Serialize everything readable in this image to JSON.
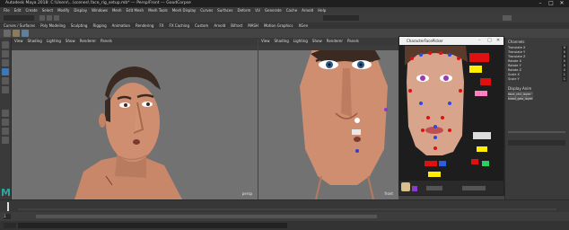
{
  "window": {
    "title": "Autodesk Maya 2018: C:\\Users\\...\\scenes\\ face_rig_setup.mb* --- Persp/Front --- GoodCorpse",
    "controls": [
      "–",
      "□",
      "✕"
    ]
  },
  "menubar": [
    "File",
    "Edit",
    "Create",
    "Select",
    "Modify",
    "Display",
    "Windows",
    "Mesh",
    "Edit Mesh",
    "Mesh Tools",
    "Mesh Display",
    "Curves",
    "Surfaces",
    "Deform",
    "UV",
    "Generate",
    "Cache",
    "Arnold",
    "Help"
  ],
  "shelf_tabs": [
    "Curves / Surfaces",
    "Poly Modeling",
    "Sculpting",
    "Rigging",
    "Animation",
    "Rendering",
    "FX",
    "FX Caching",
    "Custom",
    "Arnold",
    "Bifrost",
    "MASH",
    "Motion Graphics",
    "XGen"
  ],
  "viewport_left": {
    "menu": [
      "View",
      "Shading",
      "Lighting",
      "Show",
      "Renderer",
      "Panels"
    ],
    "camera_label": "persp"
  },
  "viewport_right": {
    "menu": [
      "View",
      "Shading",
      "Lighting",
      "Show",
      "Renderer",
      "Panels"
    ],
    "camera_label": "front"
  },
  "picker": {
    "title": "CharacterFacePicker"
  },
  "right_panel": {
    "channels_label": "Channels",
    "attrs": [
      "Translate X",
      "Translate Y",
      "Translate Z",
      "Rotate X",
      "Rotate Y",
      "Rotate Z",
      "Scale X",
      "Scale Y"
    ],
    "values": [
      "0",
      "0",
      "0",
      "0",
      "0",
      "0",
      "1",
      "1"
    ],
    "layer_label": "Display  Anim",
    "layer_items": [
      "face_ctrl_layer",
      "head_geo_layer"
    ]
  },
  "timeline": {
    "logo": "M",
    "current_frame": "1"
  },
  "colors": {
    "accent": "#2fa5a0",
    "viewport_bg": "#6e6e6e",
    "picker_bg": "#1d1d1d"
  }
}
